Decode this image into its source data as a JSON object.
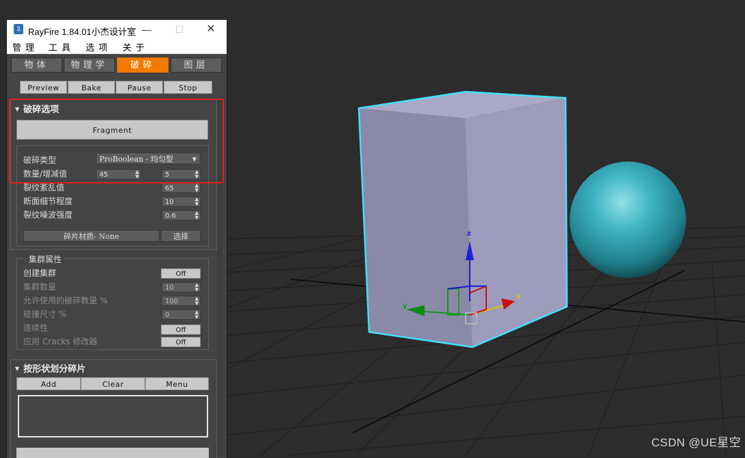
{
  "window": {
    "icon": "3",
    "title": "RayFire 1.84.01小杰设计室",
    "minimize_glyph": "—",
    "maximize_glyph": "☐",
    "close_glyph": "✕"
  },
  "menu": [
    "管理",
    "工具",
    "选项",
    "关于"
  ],
  "tabs": [
    "物体",
    "物理学",
    "破碎",
    "图层"
  ],
  "active_tab": "破碎",
  "sim_buttons": [
    "Preview",
    "Bake",
    "Pause",
    "Stop"
  ],
  "fragment_options": {
    "title": "破碎选项",
    "fragment_button": "Fragment",
    "fragment_type_label": "破碎类型",
    "fragment_type_value": "ProBoolean - 均匀型",
    "count_label": "数量/增减值",
    "count_value": "45",
    "count_variation": "5",
    "chaos_label": "裂纹紊乱值",
    "chaos_value": "65",
    "detail_label": "断面细节程度",
    "detail_value": "10",
    "noise_label": "裂纹噪波强度",
    "noise_value": "0.6",
    "material_label": "碎片材质- None",
    "select_label": "选择"
  },
  "cluster": {
    "title": "集群属性",
    "create_label": "创建集群",
    "create_value": "Off",
    "count_label": "集群数量",
    "count_value": "10",
    "percent_label": "允许使用的破碎数量 %",
    "percent_value": "100",
    "collision_label": "碰撞尺寸 %",
    "collision_value": "0",
    "continuity_label": "连续性",
    "continuity_value": "Off",
    "cracks_label": "应用 Cracks 修改器",
    "cracks_value": "Off"
  },
  "shape_fragments": {
    "title": "按形状划分碎片",
    "buttons": [
      "Add",
      "Clear",
      "Menu"
    ]
  },
  "gizmo": {
    "x": "x",
    "y": "y",
    "z": "z"
  },
  "watermark": "CSDN @UE星空",
  "colors": {
    "accent": "#f27a00",
    "highlight": "#e1201c",
    "selection": "#3fe3ff",
    "sphere": "#2d9fae"
  }
}
